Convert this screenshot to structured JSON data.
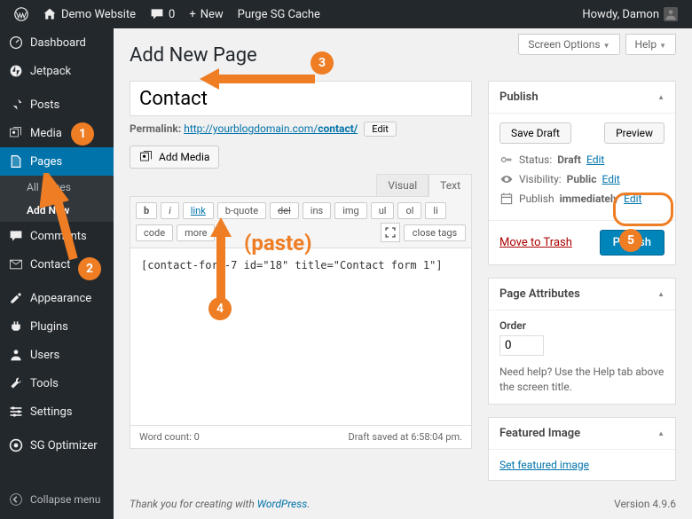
{
  "adminbar": {
    "site": "Demo Website",
    "comments": "0",
    "new": "New",
    "purge": "Purge SG Cache",
    "howdy": "Howdy, Damon"
  },
  "sidebar": {
    "items": [
      {
        "label": "Dashboard",
        "icon": "dashboard"
      },
      {
        "label": "Jetpack",
        "icon": "jetpack"
      },
      {
        "label": "Posts",
        "icon": "pin"
      },
      {
        "label": "Media",
        "icon": "media"
      },
      {
        "label": "Pages",
        "icon": "pages",
        "current": true
      },
      {
        "label": "Comments",
        "icon": "comments"
      },
      {
        "label": "Contact",
        "icon": "contact"
      },
      {
        "label": "Appearance",
        "icon": "appearance"
      },
      {
        "label": "Plugins",
        "icon": "plugins"
      },
      {
        "label": "Users",
        "icon": "users"
      },
      {
        "label": "Tools",
        "icon": "tools"
      },
      {
        "label": "Settings",
        "icon": "settings"
      },
      {
        "label": "SG Optimizer",
        "icon": "sg"
      }
    ],
    "submenu": {
      "allpages": "All Pages",
      "addnew": "Add New"
    },
    "collapse": "Collapse menu"
  },
  "screen": {
    "options": "Screen Options",
    "help": "Help"
  },
  "heading": "Add New Page",
  "title": "Contact",
  "permalink": {
    "label": "Permalink:",
    "url": "http://yourblogdomain.com/",
    "slug": "contact/",
    "edit": "Edit"
  },
  "addMedia": "Add Media",
  "tabs": {
    "visual": "Visual",
    "text": "Text"
  },
  "toolbar": [
    "b",
    "i",
    "link",
    "b-quote",
    "del",
    "ins",
    "img",
    "ul",
    "ol",
    "li",
    "code",
    "more",
    "close tags"
  ],
  "content": "[contact-form-7 id=\"18\" title=\"Contact form 1\"]",
  "statusbar": {
    "wordcount": "Word count: 0",
    "saved": "Draft saved at 6:58:04 pm."
  },
  "publish": {
    "title": "Publish",
    "saveDraft": "Save Draft",
    "preview": "Preview",
    "statusLabel": "Status:",
    "statusValue": "Draft",
    "edit": "Edit",
    "visLabel": "Visibility:",
    "visValue": "Public",
    "schedLabel": "Publish",
    "schedValue": "immediately",
    "trash": "Move to Trash",
    "button": "Publish"
  },
  "attributes": {
    "title": "Page Attributes",
    "order": "Order",
    "orderValue": "0",
    "help": "Need help? Use the Help tab above the screen title."
  },
  "featured": {
    "title": "Featured Image",
    "link": "Set featured image"
  },
  "footer": {
    "thank": "Thank you for creating with ",
    "wp": "WordPress",
    "version": "Version 4.9.6"
  },
  "annotations": {
    "paste": "(paste)"
  }
}
